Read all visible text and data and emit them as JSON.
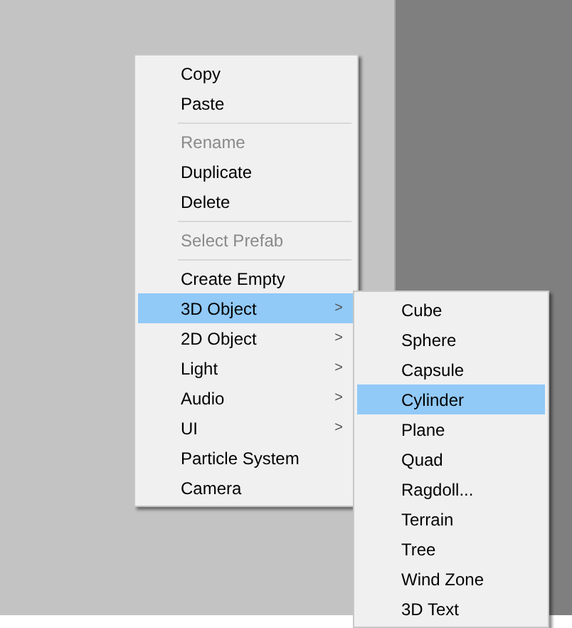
{
  "context_menu": {
    "items": [
      {
        "kind": "item",
        "label": "Copy",
        "disabled": false,
        "selected": false
      },
      {
        "kind": "item",
        "label": "Paste",
        "disabled": false,
        "selected": false
      },
      {
        "kind": "separator"
      },
      {
        "kind": "item",
        "label": "Rename",
        "disabled": true,
        "selected": false
      },
      {
        "kind": "item",
        "label": "Duplicate",
        "disabled": false,
        "selected": false
      },
      {
        "kind": "item",
        "label": "Delete",
        "disabled": false,
        "selected": false
      },
      {
        "kind": "separator"
      },
      {
        "kind": "item",
        "label": "Select Prefab",
        "disabled": true,
        "selected": false
      },
      {
        "kind": "separator"
      },
      {
        "kind": "item",
        "label": "Create Empty",
        "disabled": false,
        "selected": false
      },
      {
        "kind": "item",
        "label": "3D Object",
        "disabled": false,
        "selected": true,
        "arrow": ">"
      },
      {
        "kind": "item",
        "label": "2D Object",
        "disabled": false,
        "selected": false,
        "arrow": ">"
      },
      {
        "kind": "item",
        "label": "Light",
        "disabled": false,
        "selected": false,
        "arrow": ">"
      },
      {
        "kind": "item",
        "label": "Audio",
        "disabled": false,
        "selected": false,
        "arrow": ">"
      },
      {
        "kind": "item",
        "label": "UI",
        "disabled": false,
        "selected": false,
        "arrow": ">"
      },
      {
        "kind": "item",
        "label": "Particle System",
        "disabled": false,
        "selected": false
      },
      {
        "kind": "item",
        "label": "Camera",
        "disabled": false,
        "selected": false
      }
    ]
  },
  "submenu": {
    "items": [
      {
        "kind": "item",
        "label": "Cube",
        "disabled": false,
        "selected": false
      },
      {
        "kind": "item",
        "label": "Sphere",
        "disabled": false,
        "selected": false
      },
      {
        "kind": "item",
        "label": "Capsule",
        "disabled": false,
        "selected": false
      },
      {
        "kind": "item",
        "label": "Cylinder",
        "disabled": false,
        "selected": true
      },
      {
        "kind": "item",
        "label": "Plane",
        "disabled": false,
        "selected": false
      },
      {
        "kind": "item",
        "label": "Quad",
        "disabled": false,
        "selected": false
      },
      {
        "kind": "item",
        "label": "Ragdoll...",
        "disabled": false,
        "selected": false
      },
      {
        "kind": "item",
        "label": "Terrain",
        "disabled": false,
        "selected": false
      },
      {
        "kind": "item",
        "label": "Tree",
        "disabled": false,
        "selected": false
      },
      {
        "kind": "item",
        "label": "Wind Zone",
        "disabled": false,
        "selected": false
      },
      {
        "kind": "item",
        "label": "3D Text",
        "disabled": false,
        "selected": false
      }
    ]
  }
}
